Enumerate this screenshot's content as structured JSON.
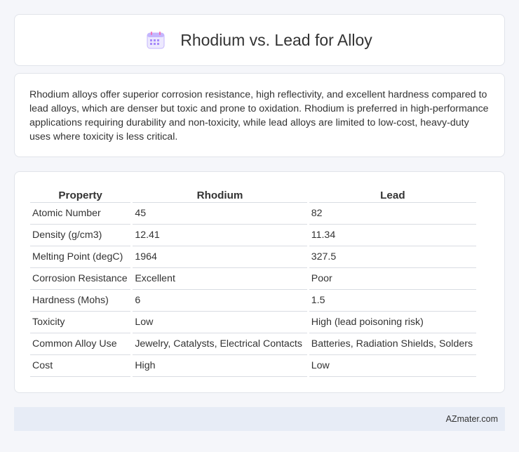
{
  "header": {
    "title": "Rhodium vs. Lead for Alloy",
    "icon": "calendar-icon"
  },
  "summary": {
    "text": "Rhodium alloys offer superior corrosion resistance, high reflectivity, and excellent hardness compared to lead alloys, which are denser but toxic and prone to oxidation. Rhodium is preferred in high-performance applications requiring durability and non-toxicity, while lead alloys are limited to low-cost, heavy-duty uses where toxicity is less critical."
  },
  "table": {
    "headers": [
      "Property",
      "Rhodium",
      "Lead"
    ],
    "rows": [
      [
        "Atomic Number",
        "45",
        "82"
      ],
      [
        "Density (g/cm3)",
        "12.41",
        "11.34"
      ],
      [
        "Melting Point (degC)",
        "1964",
        "327.5"
      ],
      [
        "Corrosion Resistance",
        "Excellent",
        "Poor"
      ],
      [
        "Hardness (Mohs)",
        "6",
        "1.5"
      ],
      [
        "Toxicity",
        "Low",
        "High (lead poisoning risk)"
      ],
      [
        "Common Alloy Use",
        "Jewelry, Catalysts, Electrical Contacts",
        "Batteries, Radiation Shields, Solders"
      ],
      [
        "Cost",
        "High",
        "Low"
      ]
    ]
  },
  "footer": {
    "site": "AZmater.com"
  },
  "colors": {
    "background": "#f5f6fa",
    "card": "#ffffff",
    "footer": "#e7ecf6",
    "icon_purple": "#a78bfa",
    "icon_top": "#f472b6"
  }
}
